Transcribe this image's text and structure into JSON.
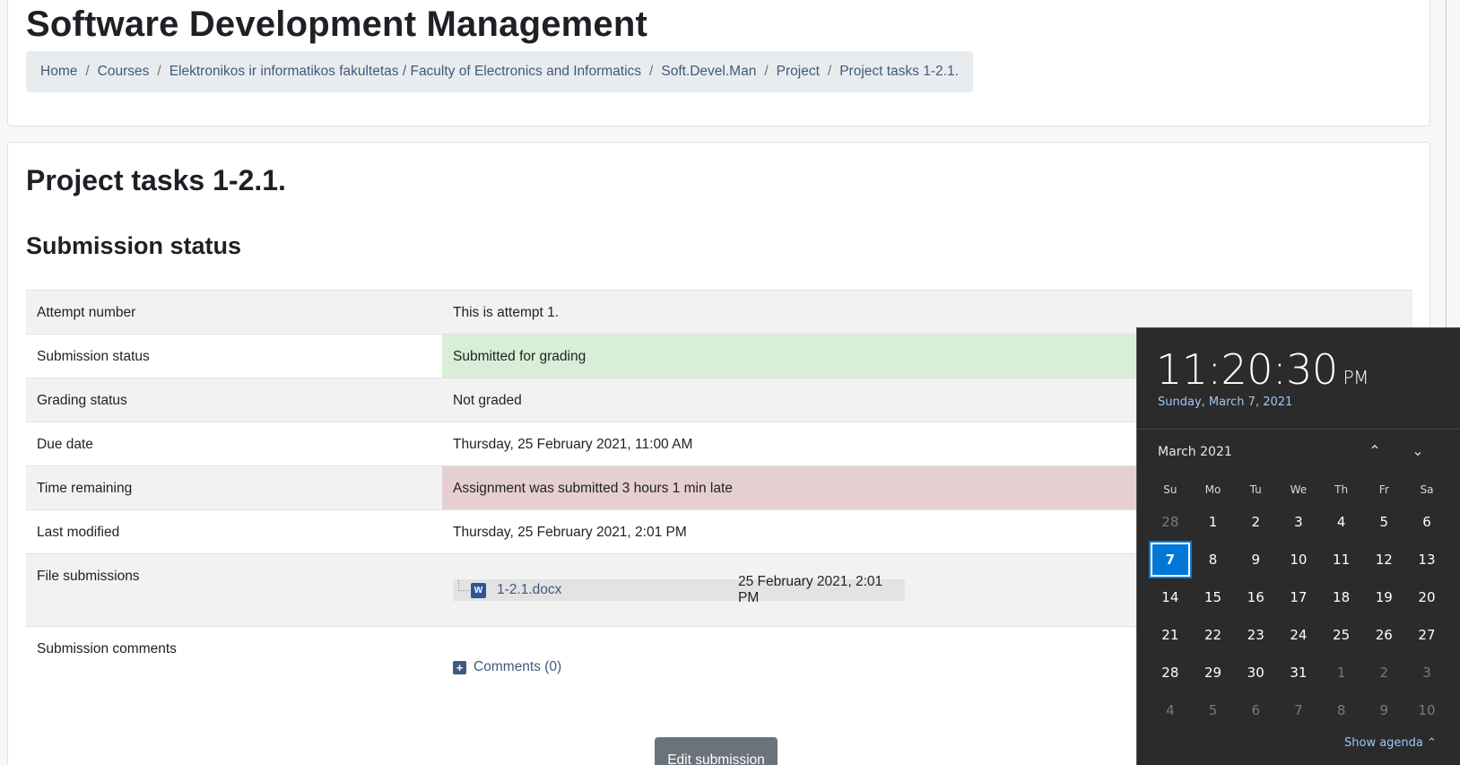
{
  "header": {
    "course_title": "Software Development Management",
    "breadcrumb": [
      "Home",
      "Courses",
      "Elektronikos ir informatikos fakultetas / Faculty of Electronics and Informatics",
      "Soft.Devel.Man",
      "Project",
      "Project tasks 1-2.1."
    ]
  },
  "main": {
    "title": "Project tasks 1-2.1.",
    "section_heading": "Submission status",
    "rows": {
      "attempt_label": "Attempt number",
      "attempt_value": "This is attempt 1.",
      "submission_label": "Submission status",
      "submission_value": "Submitted for grading",
      "grading_label": "Grading status",
      "grading_value": "Not graded",
      "due_label": "Due date",
      "due_value": "Thursday, 25 February 2021, 11:00 AM",
      "remaining_label": "Time remaining",
      "remaining_value": "Assignment was submitted 3 hours 1 min late",
      "modified_label": "Last modified",
      "modified_value": "Thursday, 25 February 2021, 2:01 PM",
      "files_label": "File submissions",
      "file_name": "1-2.1.docx",
      "file_date": "25 February 2021, 2:01 PM",
      "file_icon": "word-doc-icon",
      "comments_label": "Submission comments",
      "comments_link": "Comments (0)"
    },
    "edit_button": "Edit submission"
  },
  "clock_flyout": {
    "time": "11:20:30",
    "ampm": "PM",
    "date": "Sunday, March 7, 2021",
    "month": "March 2021",
    "weekdays": [
      "Su",
      "Mo",
      "Tu",
      "We",
      "Th",
      "Fr",
      "Sa"
    ],
    "weeks": [
      [
        "28",
        "1",
        "2",
        "3",
        "4",
        "5",
        "6"
      ],
      [
        "7",
        "8",
        "9",
        "10",
        "11",
        "12",
        "13"
      ],
      [
        "14",
        "15",
        "16",
        "17",
        "18",
        "19",
        "20"
      ],
      [
        "21",
        "22",
        "23",
        "24",
        "25",
        "26",
        "27"
      ],
      [
        "28",
        "29",
        "30",
        "31",
        "1",
        "2",
        "3"
      ],
      [
        "4",
        "5",
        "6",
        "7",
        "8",
        "9",
        "10"
      ]
    ],
    "selected_day": "7",
    "show_agenda": "Show agenda"
  },
  "colors": {
    "success_bg": "#d7efd6",
    "danger_bg": "#e6cfd0",
    "link": "#3f5a7c",
    "today_accent": "#0078d7",
    "flyout_bg": "#2b2b2b"
  }
}
